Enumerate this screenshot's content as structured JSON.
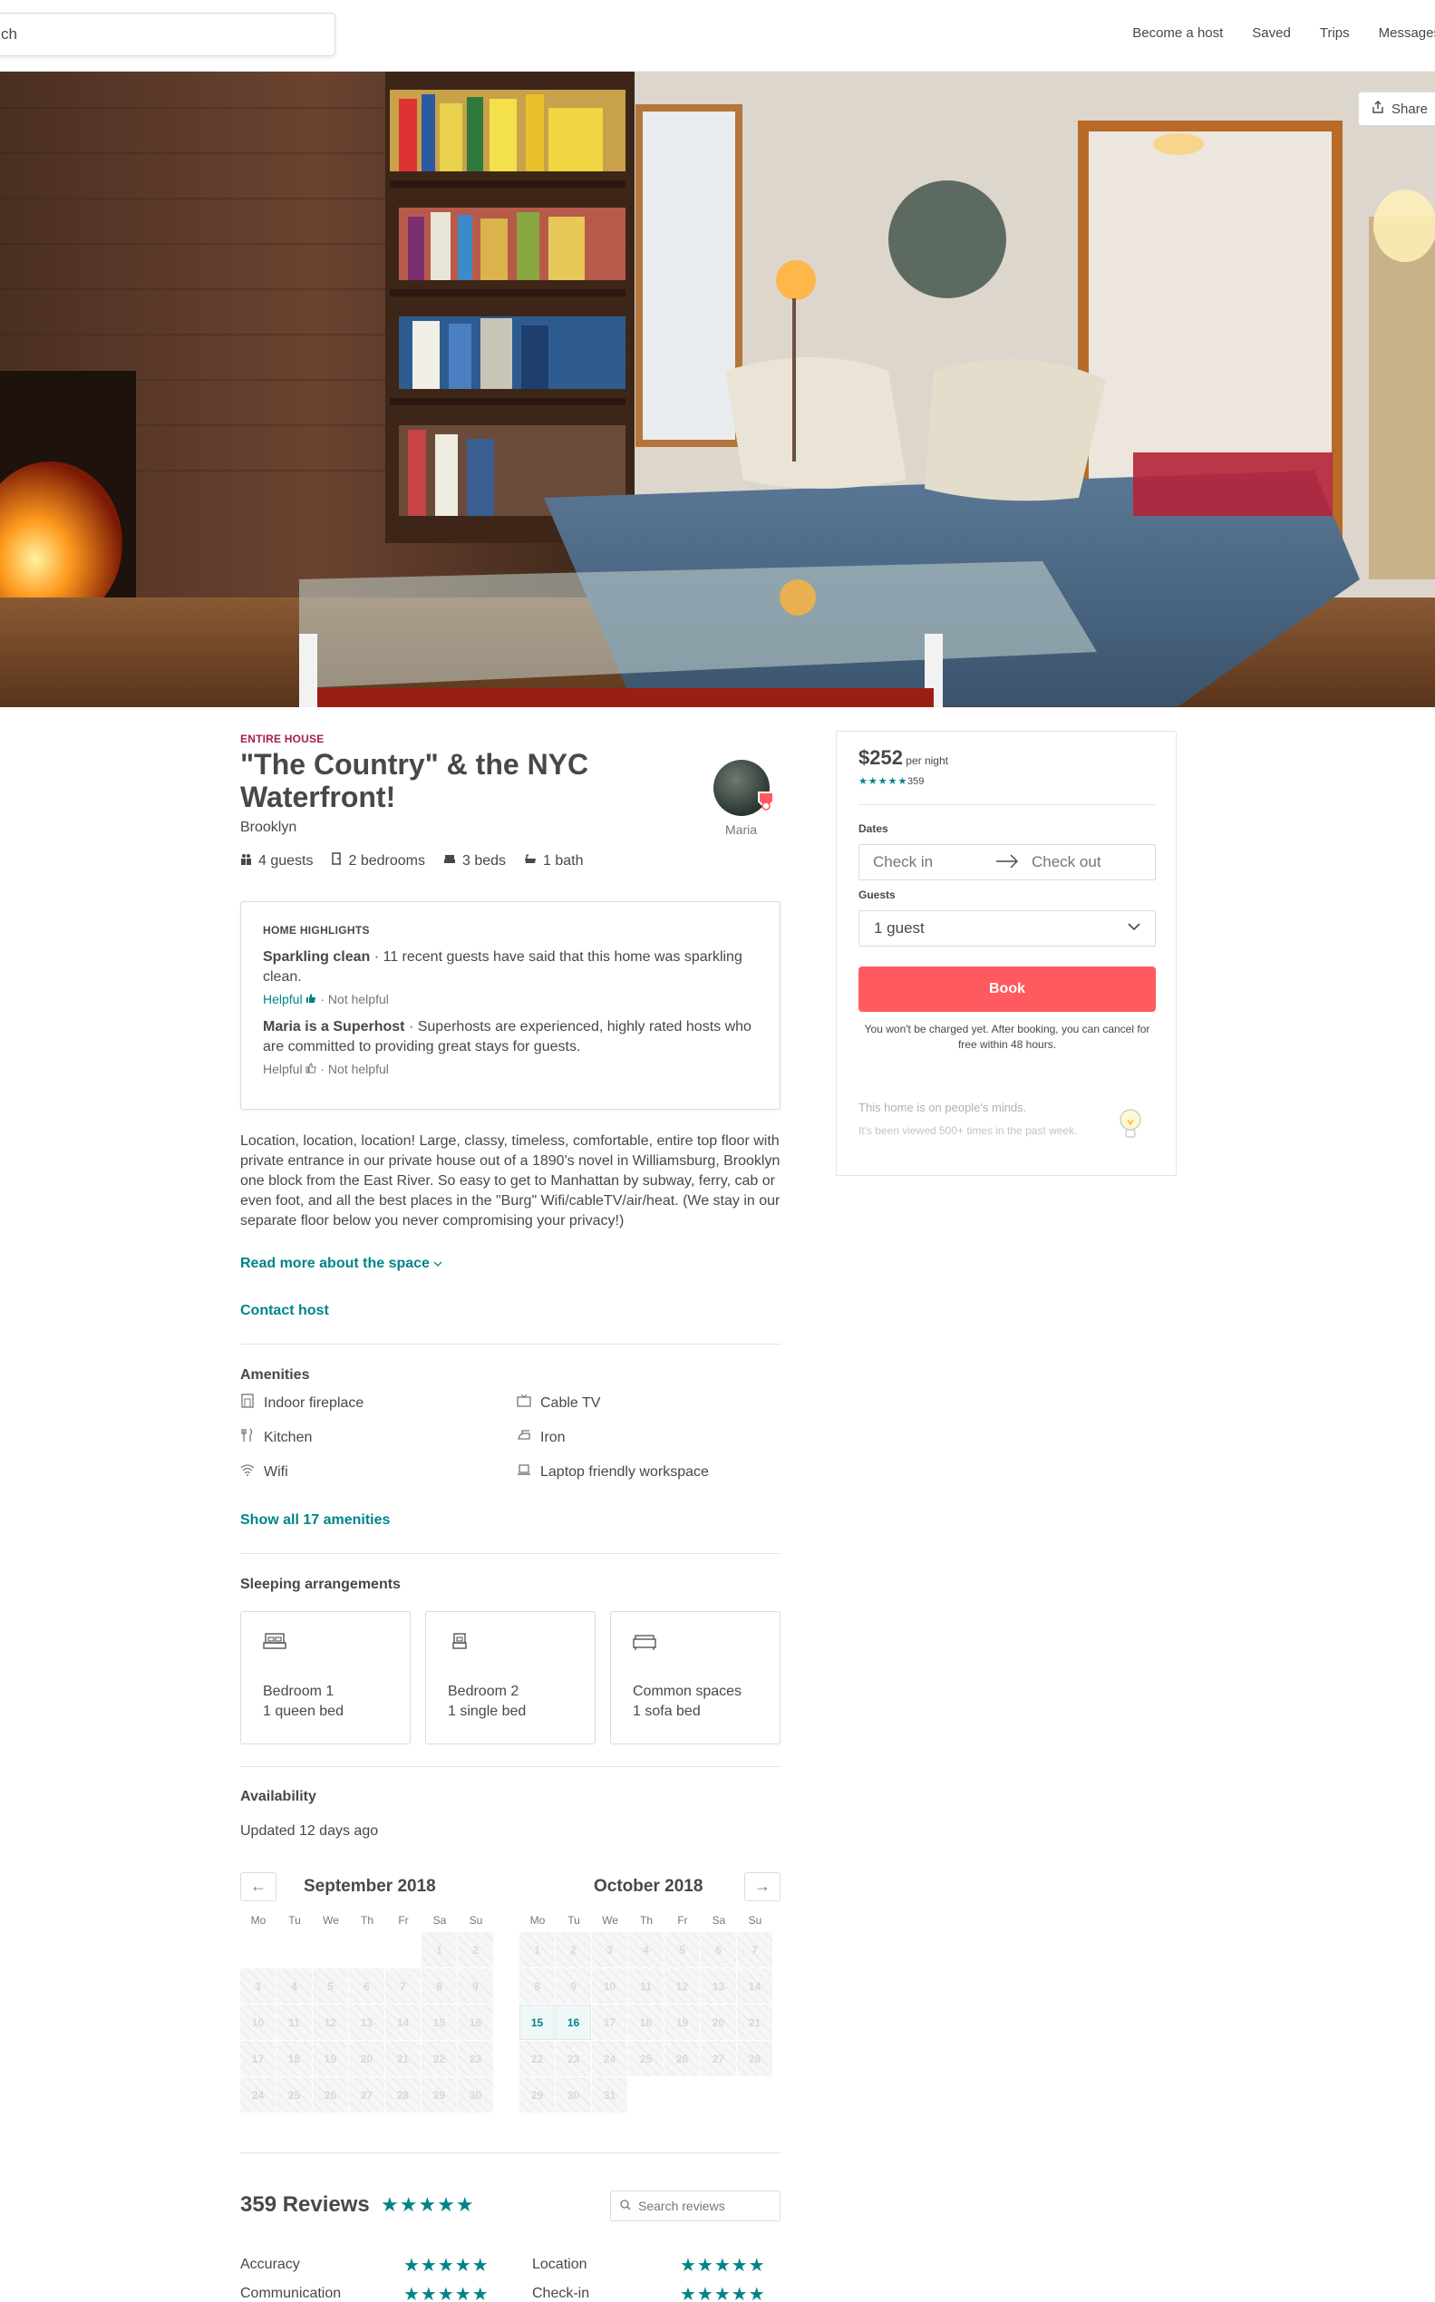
{
  "header": {
    "search_text": "ch",
    "nav": [
      "Become a host",
      "Saved",
      "Trips",
      "Messages"
    ]
  },
  "hero": {
    "share_label": "Share"
  },
  "listing": {
    "kicker": "ENTIRE HOUSE",
    "title": "\"The Country\" & the NYC Waterfront!",
    "city": "Brooklyn",
    "host_name": "Maria",
    "facts": [
      "4 guests",
      "2 bedrooms",
      "3 beds",
      "1 bath"
    ]
  },
  "highlights": {
    "heading": "HOME HIGHLIGHTS",
    "items": [
      {
        "bold": "Sparkling clean",
        "text": " · 11 recent guests have said that this home was sparkling clean.",
        "helpful": "Helpful",
        "not_helpful": " · Not helpful"
      },
      {
        "bold": "Maria is a Superhost",
        "text": " · Superhosts are experienced, highly rated hosts who are committed to providing great stays for guests.",
        "helpful": "Helpful",
        "not_helpful": " · Not helpful"
      }
    ]
  },
  "description": "Location, location, location! Large, classy, timeless, comfortable, entire top floor with private entrance in our private house out of a 1890's novel in Williamsburg, Brooklyn one block from the East River. So easy to get to Manhattan by subway, ferry, cab or even foot, and all the best places in the \"Burg\" Wifi/cableTV/air/heat. (We stay in our separate floor below you never compromising your privacy!)",
  "read_more": "Read more about the space",
  "contact_host": "Contact host",
  "amenities": {
    "title": "Amenities",
    "items": [
      "Indoor fireplace",
      "Cable TV",
      "Kitchen",
      "Iron",
      "Wifi",
      "Laptop friendly workspace"
    ],
    "icons": [
      "fireplace-icon",
      "tv-icon",
      "kitchen-icon",
      "iron-icon",
      "wifi-icon",
      "laptop-icon"
    ],
    "show_all": "Show all 17 amenities"
  },
  "sleeping": {
    "title": "Sleeping arrangements",
    "rooms": [
      {
        "name": "Bedroom 1",
        "bed": "1 queen bed"
      },
      {
        "name": "Bedroom 2",
        "bed": "1 single bed"
      },
      {
        "name": "Common spaces",
        "bed": "1 sofa bed"
      }
    ]
  },
  "availability": {
    "title": "Availability",
    "updated": "Updated 12 days ago",
    "months": [
      {
        "name": "September 2018",
        "offset": 5,
        "days": 30,
        "open": []
      },
      {
        "name": "October 2018",
        "offset": 0,
        "days": 31,
        "open": [
          15,
          16
        ]
      }
    ],
    "dow": [
      "Mo",
      "Tu",
      "We",
      "Th",
      "Fr",
      "Sa",
      "Su"
    ]
  },
  "reviews": {
    "title": "359 Reviews",
    "stars": "★★★★★",
    "search_placeholder": "Search reviews",
    "ratings": [
      {
        "label": "Accuracy",
        "stars": "★★★★★"
      },
      {
        "label": "Location",
        "stars": "★★★★★"
      },
      {
        "label": "Communication",
        "stars": "★★★★★"
      },
      {
        "label": "Check-in",
        "stars": "★★★★★"
      }
    ]
  },
  "booking": {
    "price": "$252",
    "per_night": " per night",
    "stars": "★★★★★",
    "review_count": "359",
    "dates_label": "Dates",
    "check_in": "Check in",
    "check_out": "Check out",
    "guests_label": "Guests",
    "guests_value": "1 guest",
    "book_label": "Book",
    "note": "You won't be charged yet. After booking, you can cancel for free within 48 hours.",
    "tip_title": "This home is on people's minds.",
    "tip_sub": "It's been viewed 500+ times in the past week."
  },
  "colors": {
    "accent": "#008489",
    "brand": "#ff5a5f",
    "kicker": "#a61d55"
  }
}
